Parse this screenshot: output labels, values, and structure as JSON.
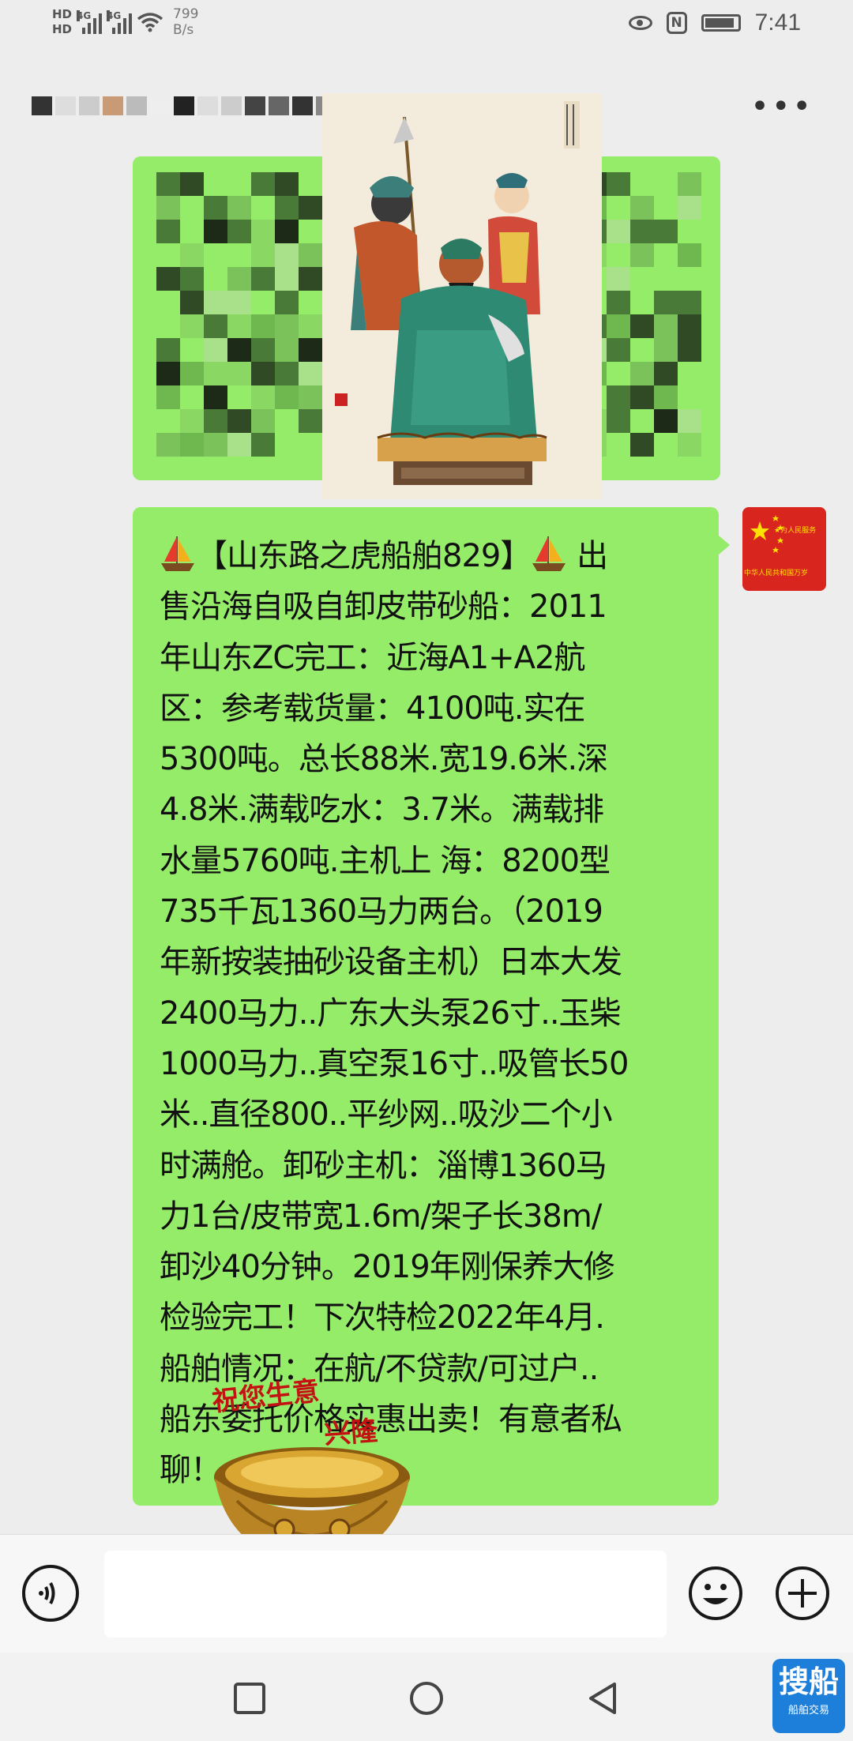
{
  "status_bar": {
    "hd1": "HD",
    "hd2": "HD",
    "net1": "4G",
    "net2": "4G",
    "speed_value": "799",
    "speed_unit": "B/s",
    "time": "7:41",
    "nfc": "N",
    "icons": [
      "eye-icon",
      "nfc-icon",
      "battery-icon"
    ]
  },
  "header": {
    "more_icon": "more-dots-icon",
    "more_label": "•••"
  },
  "messages": [
    {
      "type": "text-pixelated",
      "sender": "self"
    },
    {
      "type": "image",
      "description_icon": "painting-image"
    },
    {
      "type": "text",
      "sender": "self",
      "lines": [
        "【山东路之虎船舶829】",
        " 出",
        "售沿海自吸自卸皮带砂船：2011",
        "年山东ZC完工：近海A1+A2航",
        "区：参考载货量：4100吨.实在",
        "5300吨。总长88米.宽19.6米.深",
        "4.8米.满载吃水：3.7米。满载排",
        "水量5760吨.主机上 海：8200型",
        "735千瓦1360马力两台。（2019",
        "年新按装抽砂设备主机）日本大发",
        "2400马力..广东大头泵26寸..玉柴",
        "1000马力..真空泵16寸..吸管长50",
        "米..直径800..平纱网..吸沙二个小",
        "时满舱。卸砂主机：淄博1360马",
        "力1台/皮带宽1.6m/架子长38m/",
        "卸沙40分钟。2019年刚保养大修",
        "检验完工！下次特检2022年4月.",
        "船舶情况：在航/不贷款/可过户..",
        "船东委托价格实惠出卖！有意者私",
        "聊！"
      ]
    }
  ],
  "sticker": {
    "text_line1": "祝您生意",
    "text_line2": "兴隆"
  },
  "avatar": {
    "line1": "★为人民服务",
    "line2": "中华人民共和国万岁"
  },
  "input_bar": {
    "voice_icon": "voice-icon",
    "emoji_icon": "emoji-icon",
    "plus_icon": "plus-icon",
    "input_value": ""
  },
  "nav_bar": {
    "icons": [
      "recent-apps-icon",
      "home-icon",
      "back-icon"
    ]
  },
  "watermark": {
    "main": "搜船",
    "sub": "船舶交易"
  },
  "colors": {
    "bubble": "#95ec69",
    "background": "#ededed",
    "avatar": "#d8251e"
  }
}
